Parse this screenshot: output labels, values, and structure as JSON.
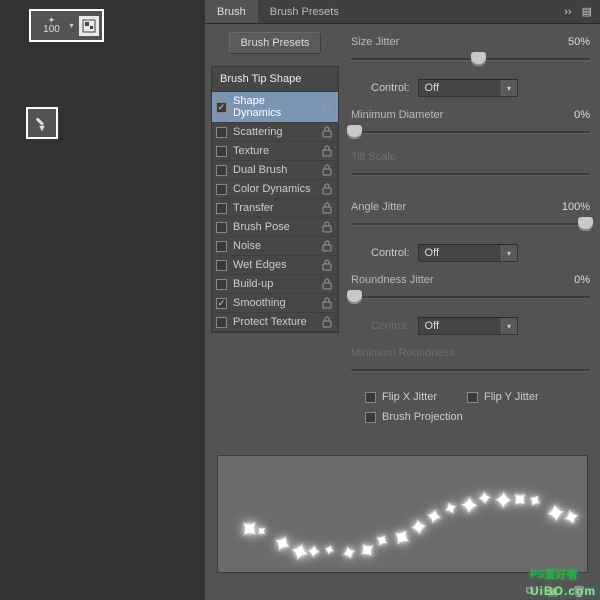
{
  "toolbar": {
    "brush_size": "100",
    "brush_glyph": "✦"
  },
  "panel": {
    "tabs": [
      "Brush",
      "Brush Presets"
    ],
    "active_tab": 0,
    "presets_button": "Brush Presets",
    "tip_shape_header": "Brush Tip Shape",
    "options": [
      {
        "label": "Shape Dynamics",
        "checked": true,
        "locked": true,
        "selected": true
      },
      {
        "label": "Scattering",
        "checked": false,
        "locked": true,
        "selected": false
      },
      {
        "label": "Texture",
        "checked": false,
        "locked": true,
        "selected": false
      },
      {
        "label": "Dual Brush",
        "checked": false,
        "locked": true,
        "selected": false
      },
      {
        "label": "Color Dynamics",
        "checked": false,
        "locked": true,
        "selected": false
      },
      {
        "label": "Transfer",
        "checked": false,
        "locked": true,
        "selected": false
      },
      {
        "label": "Brush Pose",
        "checked": false,
        "locked": true,
        "selected": false
      },
      {
        "label": "Noise",
        "checked": false,
        "locked": true,
        "selected": false
      },
      {
        "label": "Wet Edges",
        "checked": false,
        "locked": true,
        "selected": false
      },
      {
        "label": "Build-up",
        "checked": false,
        "locked": true,
        "selected": false
      },
      {
        "label": "Smoothing",
        "checked": true,
        "locked": true,
        "selected": false
      },
      {
        "label": "Protect Texture",
        "checked": false,
        "locked": true,
        "selected": false
      }
    ]
  },
  "props": {
    "size_jitter": {
      "label": "Size Jitter",
      "value": "50%",
      "thumb_pct": 50
    },
    "control1": {
      "label": "Control:",
      "value": "Off"
    },
    "min_diameter": {
      "label": "Minimum Diameter",
      "value": "0%",
      "thumb_pct": 0
    },
    "tilt_scale": {
      "label": "Tilt Scale",
      "value": "",
      "thumb_pct": 0
    },
    "angle_jitter": {
      "label": "Angle Jitter",
      "value": "100%",
      "thumb_pct": 100
    },
    "control2": {
      "label": "Control:",
      "value": "Off"
    },
    "roundness_jitter": {
      "label": "Roundness Jitter",
      "value": "0%",
      "thumb_pct": 0
    },
    "control3": {
      "label": "Control:",
      "value": "Off"
    },
    "min_roundness": {
      "label": "Minimum Roundness",
      "value": ""
    },
    "flip_x": {
      "label": "Flip X Jitter",
      "checked": false
    },
    "flip_y": {
      "label": "Flip Y Jitter",
      "checked": false
    },
    "brush_projection": {
      "label": "Brush Projection",
      "checked": false
    }
  },
  "watermark": {
    "main": "PS爱好者",
    "url": "UiBO.com"
  }
}
